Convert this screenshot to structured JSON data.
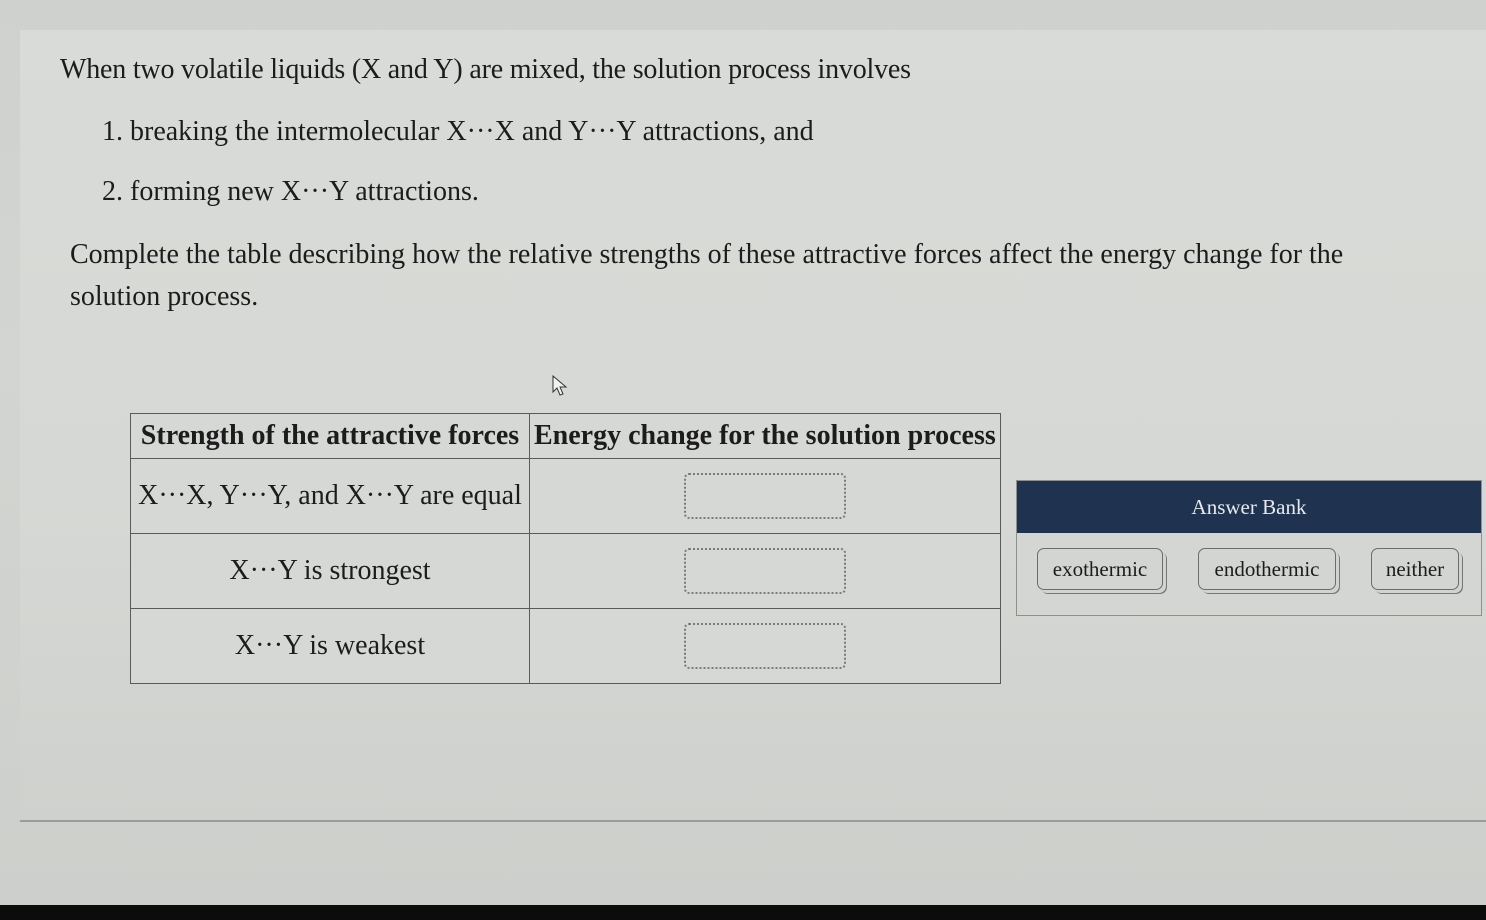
{
  "question": {
    "intro": "When two volatile liquids (X and Y) are mixed, the solution process involves",
    "steps": [
      "1. breaking the intermolecular X···X and Y···Y attractions, and",
      "2. forming new X···Y attractions."
    ],
    "instructions": "Complete the table describing how the relative strengths of these attractive forces affect the energy change for the solution process."
  },
  "table": {
    "headers": [
      "Strength of the attractive forces",
      "Energy change for the solution process"
    ],
    "rows": [
      {
        "condition": "X···X, Y···Y, and X···Y are equal",
        "answer": ""
      },
      {
        "condition": "X···Y is strongest",
        "answer": ""
      },
      {
        "condition": "X···Y is weakest",
        "answer": ""
      }
    ]
  },
  "answer_bank": {
    "title": "Answer Bank",
    "items": [
      "exothermic",
      "endothermic",
      "neither"
    ],
    "header_color": "#1f3350"
  },
  "icons": {
    "cursor": "mouse-pointer-icon"
  }
}
